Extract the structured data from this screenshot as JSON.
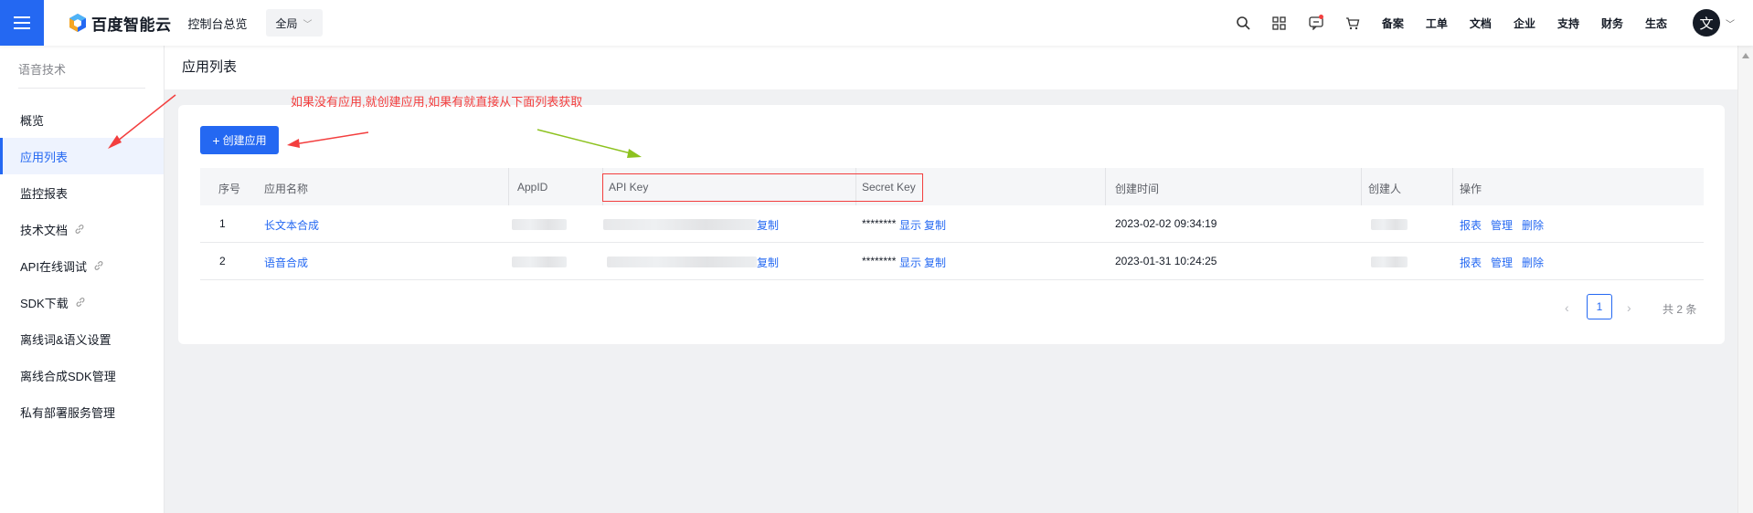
{
  "header": {
    "brand": "百度智能云",
    "console_link": "控制台总览",
    "region": "全局",
    "nav": [
      "备案",
      "工单",
      "文档",
      "企业",
      "支持",
      "财务",
      "生态"
    ],
    "avatar_letter": "文",
    "accent_color": "#2468f2"
  },
  "sidebar": {
    "title": "语音技术",
    "items": [
      {
        "label": "概览",
        "active": false,
        "external": false
      },
      {
        "label": "应用列表",
        "active": true,
        "external": false
      },
      {
        "label": "监控报表",
        "active": false,
        "external": false
      },
      {
        "label": "技术文档",
        "active": false,
        "external": true
      },
      {
        "label": "API在线调试",
        "active": false,
        "external": true
      },
      {
        "label": "SDK下载",
        "active": false,
        "external": true
      },
      {
        "label": "离线词&语义设置",
        "active": false,
        "external": false
      },
      {
        "label": "离线合成SDK管理",
        "active": false,
        "external": false
      },
      {
        "label": "私有部署服务管理",
        "active": false,
        "external": false
      }
    ]
  },
  "main": {
    "title": "应用列表",
    "annotation": "如果没有应用,就创建应用,如果有就直接从下面列表获取",
    "annotation_color": "#f33e3e",
    "create_button": "创建应用",
    "table": {
      "headers": [
        "序号",
        "应用名称",
        "AppID",
        "API Key",
        "Secret Key",
        "创建时间",
        "创建人",
        "操作"
      ],
      "rows": [
        {
          "index": "1",
          "name": "长文本合成",
          "api_key_action": "复制",
          "secret_masked": "********",
          "secret_show": "显示",
          "secret_copy": "复制",
          "created": "2023-02-02 09:34:19",
          "ops": [
            "报表",
            "管理",
            "删除"
          ]
        },
        {
          "index": "2",
          "name": "语音合成",
          "api_key_action": "复制",
          "secret_masked": "********",
          "secret_show": "显示",
          "secret_copy": "复制",
          "created": "2023-01-31 10:24:25",
          "ops": [
            "报表",
            "管理",
            "删除"
          ]
        }
      ]
    },
    "pagination": {
      "current": "1",
      "total": "共 2 条"
    }
  }
}
